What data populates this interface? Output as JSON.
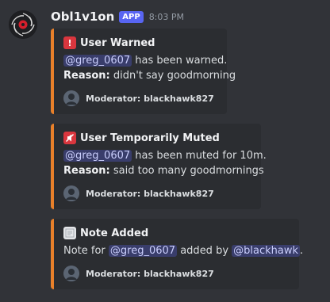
{
  "message": {
    "username": "Obl1v1on",
    "badge": "APP",
    "timestamp": "8:03 PM",
    "avatar_icon": "oblivion-spiral-logo"
  },
  "embeds": [
    {
      "icon": "exclamation-icon",
      "title": "User Warned",
      "mention": "@greg_0607",
      "text": "has been warned.",
      "reason_label": "Reason:",
      "reason": "didn't say goodmorning",
      "footer": "Moderator: blackhawk827"
    },
    {
      "icon": "muted-speaker-icon",
      "title": "User Temporarily Muted",
      "mention": "@greg_0607",
      "text": "has been muted for 10m.",
      "reason_label": "Reason:",
      "reason": "said too many goodmornings",
      "footer": "Moderator: blackhawk827"
    },
    {
      "icon": "note-icon",
      "title": "Note Added",
      "prefix": "Note for",
      "mention": "@greg_0607",
      "middle": "added by",
      "mention2": "@blackhawk",
      "suffix": ".",
      "footer": "Moderator: blackhawk827"
    }
  ],
  "colors": {
    "background": "#313338",
    "embed_background": "#2b2d31",
    "embed_accent": "#e8802a",
    "badge": "#5865f2",
    "mention_text": "#c9cdfb"
  }
}
